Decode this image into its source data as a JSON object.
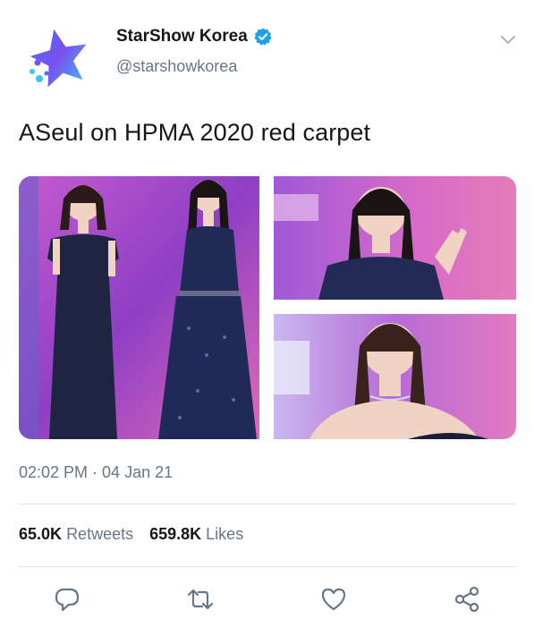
{
  "account": {
    "display_name": "StarShow Korea",
    "handle": "@starshowkorea",
    "verified": true,
    "avatar_icon": "star-logo-icon"
  },
  "tweet": {
    "text": "ASeul on HPMA 2020 red carpet",
    "timestamp": "02:02 PM · 04 Jan 21",
    "photos": [
      {
        "icon": "photo-full-length-two-women"
      },
      {
        "icon": "photo-woman-waving"
      },
      {
        "icon": "photo-woman-closeup"
      }
    ]
  },
  "stats": {
    "retweets_count": "65.0K",
    "retweets_label": "Retweets",
    "likes_count": "659.8K",
    "likes_label": "Likes"
  },
  "actions": {
    "reply_icon": "reply-icon",
    "retweet_icon": "retweet-icon",
    "like_icon": "heart-icon",
    "share_icon": "share-icon"
  },
  "colors": {
    "text": "#14171a",
    "secondary": "#657786",
    "verified": "#1da1f2",
    "divider": "#e1e8ed",
    "icon": "#657786"
  }
}
